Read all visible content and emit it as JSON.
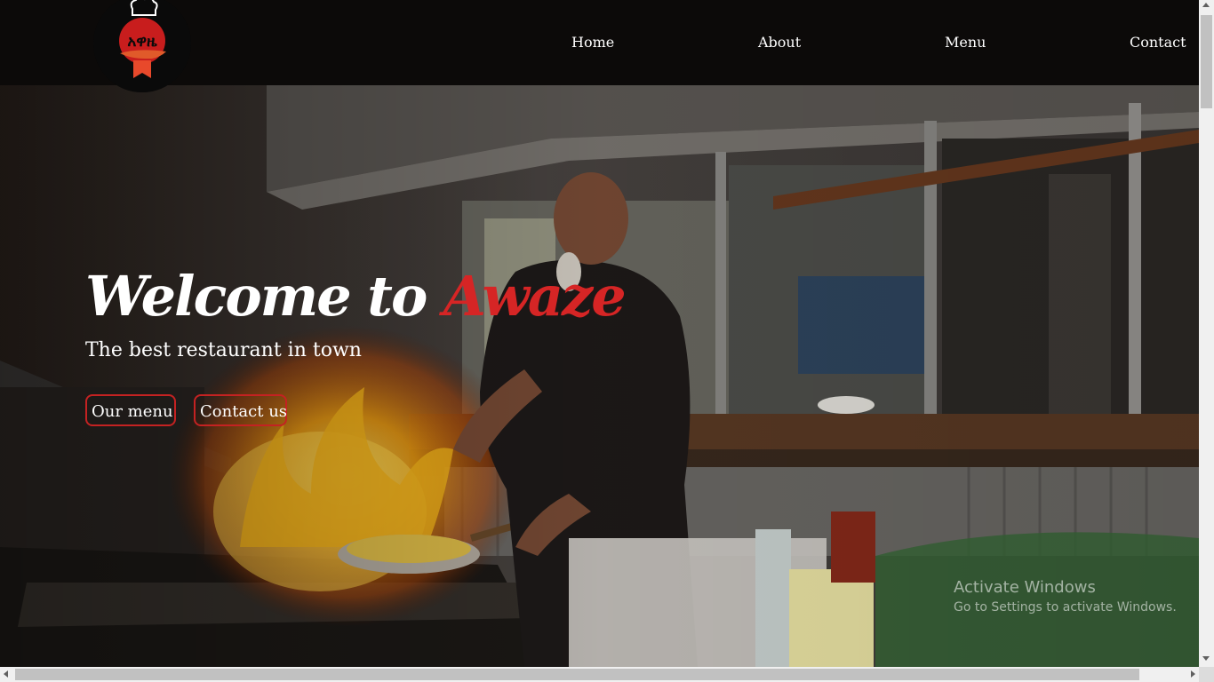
{
  "header": {
    "logo_text": "አዋዜ",
    "nav": [
      {
        "label": "Home"
      },
      {
        "label": "About"
      },
      {
        "label": "Menu"
      },
      {
        "label": "Contact"
      }
    ]
  },
  "hero": {
    "title_prefix": "Welcome to ",
    "title_accent": "Awaze",
    "subtitle": "The best restaurant in town",
    "buttons": {
      "menu_label": "Our menu",
      "contact_label": "Contact us"
    },
    "accent_color": "#d62525"
  },
  "watermark": {
    "title": "Activate Windows",
    "subtitle": "Go to Settings to activate Windows."
  }
}
